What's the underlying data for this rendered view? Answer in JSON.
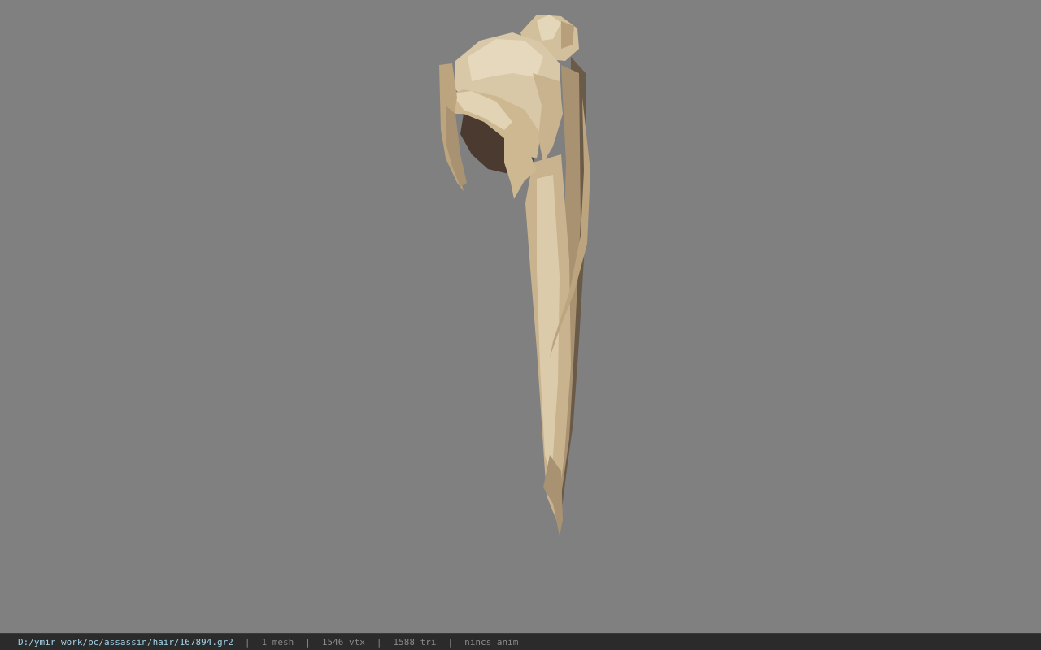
{
  "statusbar": {
    "file_path": "D:/ymir work/pc/assassin/hair/167894.gr2",
    "separator": "|",
    "mesh_count": "1 mesh",
    "vertex_count": "1546 vtx",
    "triangle_count": "1588 tri",
    "anim_status": "nincs anim"
  },
  "viewport": {
    "model_icon": "hair-mesh-model",
    "background_color": "#808080"
  },
  "colors": {
    "hair_light": "#d8c8a8",
    "hair_mid": "#c9b38e",
    "hair_dark": "#9a8462",
    "scalp": "#4a3a30",
    "status_path": "#9fd2e8",
    "status_text": "#8a8a8a"
  }
}
